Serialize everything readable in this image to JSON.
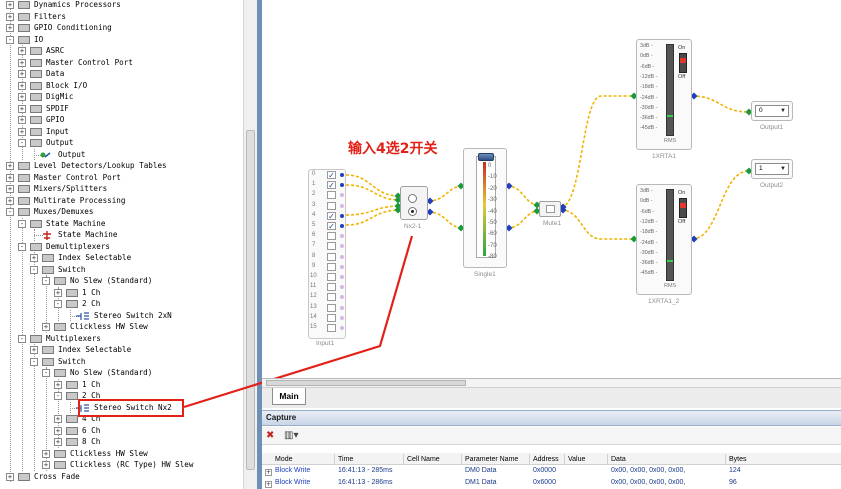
{
  "tree": {
    "items": [
      {
        "label": "Dynamics Processors",
        "level": 1,
        "icon": "folder",
        "exp": "+"
      },
      {
        "label": "Filters",
        "level": 1,
        "icon": "folder",
        "exp": "+"
      },
      {
        "label": "GPIO Conditioning",
        "level": 1,
        "icon": "folder",
        "exp": "+"
      },
      {
        "label": "IO",
        "level": 1,
        "icon": "folder",
        "exp": "-"
      },
      {
        "label": "ASRC",
        "level": 2,
        "icon": "folder",
        "exp": "+"
      },
      {
        "label": "Master Control Port",
        "level": 2,
        "icon": "folder",
        "exp": "+"
      },
      {
        "label": "Data",
        "level": 2,
        "icon": "folder",
        "exp": "+"
      },
      {
        "label": "Block I/O",
        "level": 2,
        "icon": "folder",
        "exp": "+"
      },
      {
        "label": "DigMic",
        "level": 2,
        "icon": "folder",
        "exp": "+"
      },
      {
        "label": "SPDIF",
        "level": 2,
        "icon": "folder",
        "exp": "+"
      },
      {
        "label": "GPIO",
        "level": 2,
        "icon": "folder",
        "exp": "+"
      },
      {
        "label": "Input",
        "level": 2,
        "icon": "folder",
        "exp": "+"
      },
      {
        "label": "Output",
        "level": 2,
        "icon": "folder",
        "exp": "-"
      },
      {
        "label": "Output",
        "level": 3,
        "icon": "output",
        "exp": ""
      },
      {
        "label": "Level Detectors/Lookup Tables",
        "level": 1,
        "icon": "folder",
        "exp": "+"
      },
      {
        "label": "Master Control Port",
        "level": 1,
        "icon": "folder",
        "exp": "+"
      },
      {
        "label": "Mixers/Splitters",
        "level": 1,
        "icon": "folder",
        "exp": "+"
      },
      {
        "label": "Multirate Processing",
        "level": 1,
        "icon": "folder",
        "exp": "+"
      },
      {
        "label": "Muxes/Demuxes",
        "level": 1,
        "icon": "folder",
        "exp": "-"
      },
      {
        "label": "State Machine",
        "level": 2,
        "icon": "folder",
        "exp": "-"
      },
      {
        "label": "State Machine",
        "level": 3,
        "icon": "state",
        "exp": ""
      },
      {
        "label": "Demultiplexers",
        "level": 2,
        "icon": "folder",
        "exp": "-"
      },
      {
        "label": "Index Selectable",
        "level": 3,
        "icon": "folder",
        "exp": "+"
      },
      {
        "label": "Switch",
        "level": 3,
        "icon": "folder",
        "exp": "-"
      },
      {
        "label": "No Slew (Standard)",
        "level": 4,
        "icon": "folder",
        "exp": "-"
      },
      {
        "label": "1 Ch",
        "level": 5,
        "icon": "folder",
        "exp": "+"
      },
      {
        "label": "2 Ch",
        "level": 5,
        "icon": "folder",
        "exp": "-"
      },
      {
        "label": "Stereo Switch 2xN",
        "level": 6,
        "icon": "switch",
        "exp": ""
      },
      {
        "label": "Clickless HW Slew",
        "level": 4,
        "icon": "folder",
        "exp": "+"
      },
      {
        "label": "Multiplexers",
        "level": 2,
        "icon": "folder",
        "exp": "-"
      },
      {
        "label": "Index Selectable",
        "level": 3,
        "icon": "folder",
        "exp": "+"
      },
      {
        "label": "Switch",
        "level": 3,
        "icon": "folder",
        "exp": "-"
      },
      {
        "label": "No Slew (Standard)",
        "level": 4,
        "icon": "folder",
        "exp": "-"
      },
      {
        "label": "1 Ch",
        "level": 5,
        "icon": "folder",
        "exp": "+"
      },
      {
        "label": "2 Ch",
        "level": 5,
        "icon": "folder",
        "exp": "-"
      },
      {
        "label": "Stereo Switch Nx2",
        "level": 6,
        "icon": "switch",
        "exp": ""
      },
      {
        "label": "4 Ch",
        "level": 5,
        "icon": "folder",
        "exp": "+"
      },
      {
        "label": "6 Ch",
        "level": 5,
        "icon": "folder",
        "exp": "+"
      },
      {
        "label": "8 Ch",
        "level": 5,
        "icon": "folder",
        "exp": "+"
      },
      {
        "label": "Clickless HW Slew",
        "level": 4,
        "icon": "folder",
        "exp": "+"
      },
      {
        "label": "Clickless (RC Type) HW Slew",
        "level": 4,
        "icon": "folder",
        "exp": "+"
      },
      {
        "label": "Cross Fade",
        "level": 1,
        "icon": "folder",
        "exp": "+"
      }
    ]
  },
  "canvas": {
    "annotation": "输入4选2开关",
    "input": {
      "caption": "Input1",
      "channels": [
        "0",
        "1",
        "2",
        "3",
        "4",
        "5",
        "6",
        "7",
        "8",
        "9",
        "10",
        "11",
        "12",
        "13",
        "14",
        "15"
      ],
      "checked": [
        true,
        true,
        false,
        false,
        true,
        true,
        false,
        false,
        false,
        false,
        false,
        false,
        false,
        false,
        false,
        false
      ]
    },
    "switch": {
      "caption": "Nx2-1"
    },
    "single": {
      "caption": "Single1",
      "ticks": [
        "0",
        "-10",
        "-20",
        "-30",
        "-40",
        "-50",
        "-60",
        "-70",
        "-80"
      ]
    },
    "mute": {
      "caption": "Mute1"
    },
    "rta1": {
      "caption": "1XRTA1",
      "ticks": [
        "3dB -",
        "0dB -",
        "-6dB -",
        "-12dB -",
        "-18dB -",
        "-24dB -",
        "-30dB -",
        "-36dB -",
        "-45dB -"
      ],
      "on": "On",
      "off": "Off",
      "rms": "RMS"
    },
    "rta2": {
      "caption": "1XRTA1_2",
      "ticks": [
        "3dB -",
        "0dB -",
        "-6dB -",
        "-12dB -",
        "-18dB -",
        "-24dB -",
        "-30dB -",
        "-36dB -",
        "-45dB -"
      ],
      "on": "On",
      "off": "Off",
      "rms": "RMS"
    },
    "output1": {
      "caption": "Output1",
      "value": "0"
    },
    "output2": {
      "caption": "Output2",
      "value": "1"
    }
  },
  "tabs": [
    {
      "label": "Main",
      "active": true
    }
  ],
  "capture": {
    "title": "Capture",
    "columns": [
      "Mode",
      "Time",
      "Cell Name",
      "Parameter Name",
      "Address",
      "Value",
      "Data",
      "Bytes"
    ],
    "rows": [
      {
        "mode": "Block Write",
        "time": "16:41:13 - 285ms",
        "cell": "",
        "param": "DM0 Data",
        "address": "0x0000",
        "value": "",
        "data": "0x00, 0x00, 0x00, 0x00,",
        "bytes": "124"
      },
      {
        "mode": "Block Write",
        "time": "16:41:13 - 286ms",
        "cell": "",
        "param": "DM1 Data",
        "address": "0x6000",
        "value": "",
        "data": "0x00, 0x00, 0x00, 0x00,",
        "bytes": "96"
      }
    ]
  },
  "colors": {
    "annotation": "#e32118",
    "wire": "#f0b400",
    "pin": "#1a9a3a",
    "link": "#1f3fbf"
  }
}
